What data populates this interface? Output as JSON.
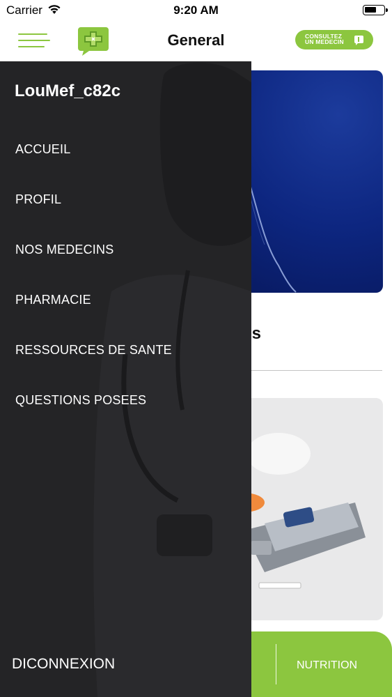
{
  "status_bar": {
    "carrier": "Carrier",
    "time": "9:20 AM",
    "battery_level": 0.65
  },
  "nav": {
    "title": "General",
    "consult_line1": "CONSULTEZ",
    "consult_line2": "UN MEDECIN",
    "icons": {
      "menu": "hamburger-icon",
      "logo": "app-logo-cross",
      "consult": "chat-icon"
    }
  },
  "drawer": {
    "username": "LouMef_c82c",
    "items": [
      {
        "label": "ACCUEIL"
      },
      {
        "label": "PROFIL"
      },
      {
        "label": "NOS MEDECINS"
      },
      {
        "label": "PHARMACIE"
      },
      {
        "label": "RESSOURCES DE SANTE"
      },
      {
        "label": "QUESTIONS POSEES"
      }
    ],
    "logout": "DICONNEXION"
  },
  "content": {
    "section_heading_fragment": "ires",
    "bottom_tab": "NUTRITION"
  },
  "colors": {
    "accent": "#8cc63f",
    "drawer_bg": "#242426",
    "banner_blue": "#0d2680"
  }
}
